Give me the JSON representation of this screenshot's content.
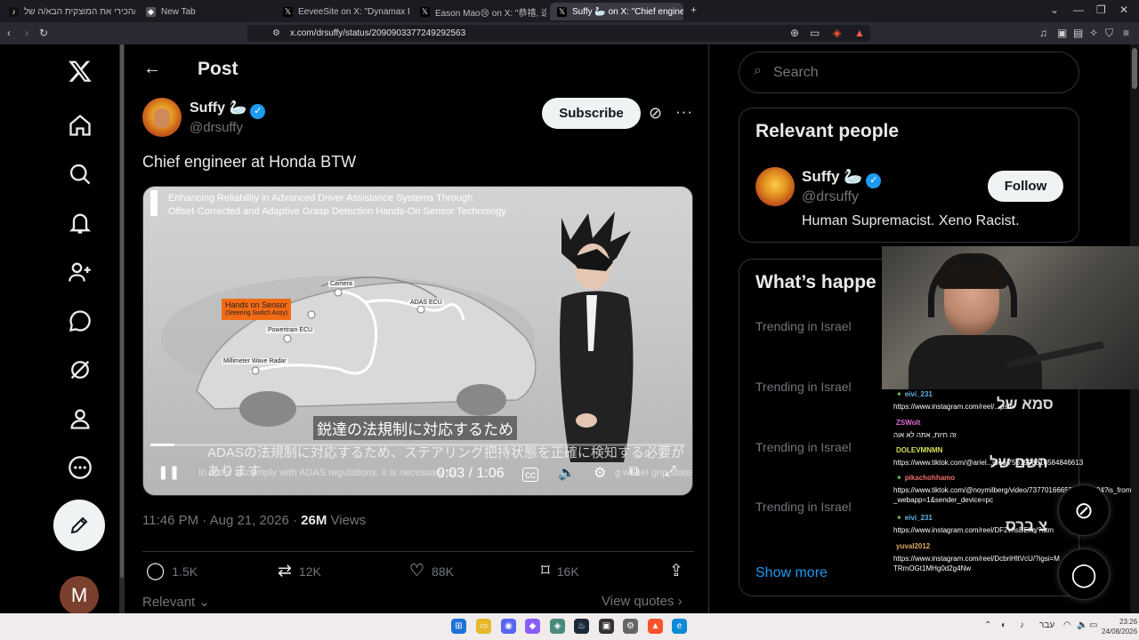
{
  "browser": {
    "tabs": [
      {
        "label": "הכר/הכירי את המוצקית הבא/ה של"
      },
      {
        "label": "New Tab"
      },
      {
        "label": "EeveeSite on X: \"Dynamax Boss batt"
      },
      {
        "label": "Eason Mao😢 on X: \"恭禧, 这个一顿"
      },
      {
        "label": "Suffy 🦢 on X: \"Chief engine"
      }
    ],
    "url": "x.com/drsuffy/status/2090903377249292563"
  },
  "page": {
    "header_title": "Post",
    "author": {
      "name": "Suffy 🦢",
      "handle": "@drsuffy"
    },
    "subscribe_label": "Subscribe",
    "tweet_text": "Chief engineer at Honda BTW",
    "video": {
      "title_line1": "Enhancing Reliability in Advanced Driver Assistance Systems Through",
      "title_line2": "Offset-Corrected and Adaptive Grasp Detection Hands-On Sensor Technology",
      "labels": {
        "camera": "Camera",
        "adas_ecu": "ADAS ECU",
        "hands_on": "Hands on Sensor",
        "hands_on_sub": "(Steering Switch Assy)",
        "powertrain": "Powertrain ECU",
        "radar": "Millimeter Wave Radar"
      },
      "subtitle_jp": "鋭達の法規制に対応するため",
      "subtitle_jp2": "ADASの法規制に対応するため、ステアリング把持状態を正確に検知する必要があります",
      "subtitle_en": "In order to comply with ADAS regulations, it is necessary to",
      "subtitle_en_end": "g wheel grip state",
      "timecode": "0:03 / 1:06",
      "progress": 0.045
    },
    "timestamp": "11:46 PM · Aug 21, 2026 · ",
    "views_count": "26M",
    "views_label": " Views",
    "actions": {
      "replies": "1.5K",
      "reposts": "12K",
      "likes": "88K",
      "bookmarks": "16K"
    },
    "relevant_label": "Relevant",
    "view_quotes_label": "View quotes"
  },
  "sidebar": {
    "search_placeholder": "Search",
    "relevant_people": {
      "heading": "Relevant people",
      "name": "Suffy 🦢",
      "handle": "@drsuffy",
      "follow_label": "Follow",
      "bio": "Human Supremacist. Xeno Racist."
    },
    "trending": {
      "heading": "What’s happe",
      "items": [
        "Trending in Israel",
        "Trending in Israel",
        "Trending in Israel",
        "Trending in Israel"
      ],
      "show_more": "Show more"
    }
  },
  "nav": {
    "avatar_letter": "M"
  },
  "chat": [
    {
      "user": "eivi_231",
      "color": "#5fb3e8",
      "msg": "https://www.instagram.com/reel/...psm",
      "star": true
    },
    {
      "user": "ZSWolt",
      "color": "#e06fd6",
      "msg": "זה חיות, אתה לא אוה",
      "star": false
    },
    {
      "user": "DOLEVMNMN",
      "color": "#d6e05f",
      "msg": "https://www.tiktok.com/@ariel...ideo/7561998816584846613",
      "star": false
    },
    {
      "user": "pikachohhamo",
      "color": "#f06c6c",
      "msg": "https://www.tiktok.com/@noymilberg/video/7377016665336253704?is_from_webapp=1&sender_device=pc",
      "star": true
    },
    {
      "user": "eivi_231",
      "color": "#5fb3e8",
      "msg": "https://www.instagram.com/reel/DF2vhsBEfiq/?utm",
      "star": true
    },
    {
      "user": "yuval2012",
      "color": "#e0a85f",
      "msg": "https://www.instagram.com/reel/DcbriHltVcU/?igsi=MTRmOGt1MHg0d2g4Nw",
      "star": false
    }
  ],
  "chat_overlay_text": {
    "line1": "סמא של",
    "line2": "השם של",
    "line3": "צ ברס"
  },
  "taskbar": {
    "lang": "עבר",
    "time": "23:26",
    "date": "24/08/2026"
  },
  "colors": {
    "accent": "#1d9bf0",
    "bg": "#000000",
    "muted": "#71767b"
  }
}
